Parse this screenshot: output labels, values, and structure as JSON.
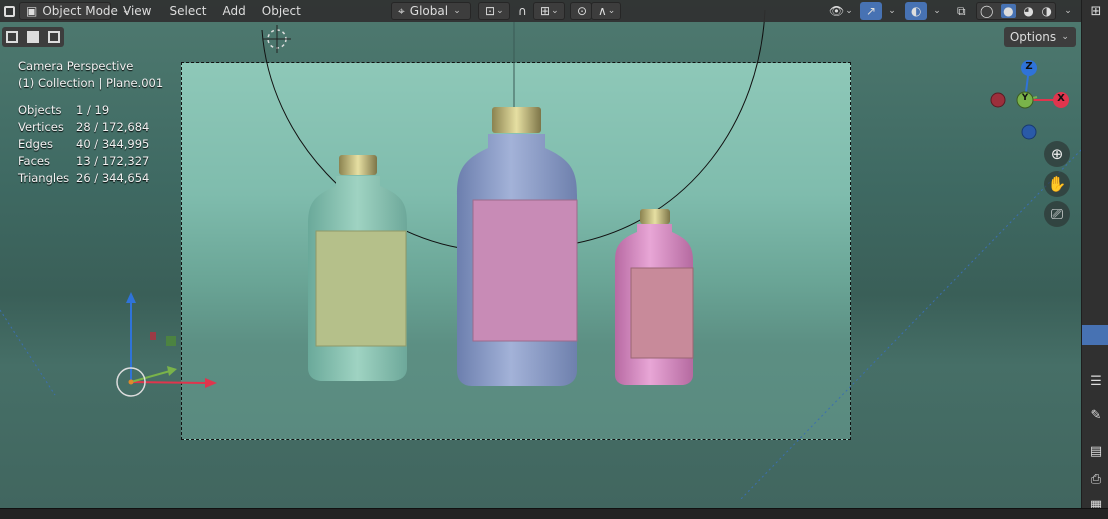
{
  "header": {
    "mode_label": "Object Mode",
    "menu": [
      "View",
      "Select",
      "Add",
      "Object"
    ],
    "orientation_label": "Global"
  },
  "toolbar": {
    "options_label": "Options"
  },
  "overlay": {
    "view_name": "Camera Perspective",
    "collection": "(1) Collection | Plane.001",
    "stats": [
      {
        "label": "Objects",
        "value": "1 / 19"
      },
      {
        "label": "Vertices",
        "value": "28 / 172,684"
      },
      {
        "label": "Edges",
        "value": "40 / 344,995"
      },
      {
        "label": "Faces",
        "value": "13 / 172,327"
      },
      {
        "label": "Triangles",
        "value": "26 / 344,654"
      }
    ]
  },
  "gizmo": {
    "z": "Z",
    "x": "X",
    "y": "Y"
  },
  "icons": {
    "editor_type": "3d-viewport-icon",
    "orientation": "transform-orientation-icon",
    "pivot": "pivot-point-icon",
    "snap": "snap-magnet-icon",
    "snap_target": "snap-increment-icon",
    "proportional": "proportional-edit-icon",
    "falloff": "falloff-curve-icon",
    "visibility": "object-visibility-icon",
    "gizmos": "gizmo-toggle-icon",
    "overlays": "overlays-icon",
    "xray": "xray-icon",
    "wireframe": "wireframe-shading-icon",
    "solid": "solid-shading-icon",
    "material": "material-preview-icon",
    "rendered": "rendered-shading-icon",
    "zoom": "zoom-icon",
    "pan": "pan-hand-icon",
    "camera": "camera-view-icon"
  },
  "colors": {
    "x_axis": "#e0354d",
    "y_axis": "#7ab34a",
    "z_axis": "#2f73d9",
    "active_blue": "#4772b3",
    "bottle_left": "#8dc4b0",
    "bottle_mid": "#8a9cc8",
    "bottle_right": "#d48cc0",
    "label_left": "#b5c08a",
    "label_mid": "#c88bb6",
    "label_right": "#c88a9a"
  }
}
